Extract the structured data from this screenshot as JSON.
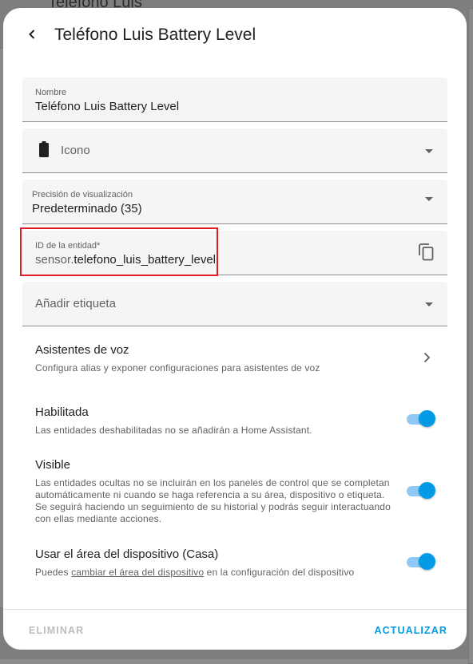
{
  "background": {
    "title": "Teléfono Luis"
  },
  "dialog": {
    "title": "Teléfono Luis Battery Level",
    "back_icon": "chevron-left-icon"
  },
  "fields": {
    "name": {
      "label": "Nombre",
      "value": "Teléfono Luis Battery Level"
    },
    "icon": {
      "placeholder": "Icono",
      "icon": "battery-icon"
    },
    "precision": {
      "label": "Precisión de visualización",
      "value": "Predeterminado (35)"
    },
    "entity_id": {
      "label": "ID de la entidad*",
      "prefix": "sensor.",
      "value": "telefono_luis_battery_level",
      "copy_icon": "copy-icon"
    },
    "label": {
      "placeholder": "Añadir etiqueta"
    }
  },
  "voice": {
    "title": "Asistentes de voz",
    "description": "Configura alias y exponer configuraciones para asistentes de voz"
  },
  "enabled": {
    "title": "Habilitada",
    "description": "Las entidades deshabilitadas no se añadirán a Home Assistant.",
    "state": true
  },
  "visible": {
    "title": "Visible",
    "description": "Las entidades ocultas no se incluirán en los paneles de control que se completan automáticamente ni cuando se haga referencia a su área, dispositivo o etiqueta. Se seguirá haciendo un seguimiento de su historial y podrás seguir interactuando con ellas mediante acciones.",
    "state": true
  },
  "device_area": {
    "title": "Usar el área del dispositivo (Casa)",
    "desc_before": "Puedes ",
    "desc_link": "cambiar el área del dispositivo",
    "desc_after": " en la configuración del dispositivo",
    "state": true
  },
  "actions": {
    "delete": "ELIMINAR",
    "update": "ACTUALIZAR"
  },
  "colors": {
    "accent": "#039be5",
    "highlight": "#e01c24",
    "disabled": "#bdbdbd"
  }
}
